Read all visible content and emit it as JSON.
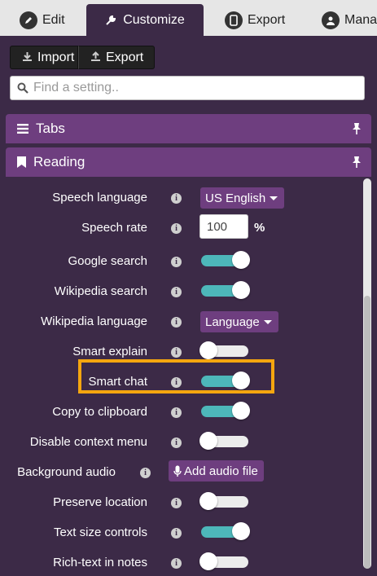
{
  "tabs": [
    {
      "label": "Edit",
      "icon": "pencil-icon",
      "active": false
    },
    {
      "label": "Customize",
      "icon": "wrench-icon",
      "active": true
    },
    {
      "label": "Export",
      "icon": "phone-icon",
      "active": false
    },
    {
      "label": "Manag",
      "icon": "user-icon",
      "active": false
    }
  ],
  "toolbar": {
    "import_label": "Import",
    "export_label": "Export"
  },
  "search": {
    "placeholder": "Find a setting.."
  },
  "panels": {
    "tabs": "Tabs",
    "reading": "Reading"
  },
  "colors": {
    "accent_purple": "#6e3e7f",
    "background": "#3c2a47",
    "toggle_on": "#4db7ba",
    "highlight": "#f5a60f"
  },
  "settings": {
    "speech_language": {
      "label": "Speech language",
      "value": "US English"
    },
    "speech_rate": {
      "label": "Speech rate",
      "value": "100",
      "unit": "%"
    },
    "google_search": {
      "label": "Google search",
      "on": true
    },
    "wikipedia_search": {
      "label": "Wikipedia search",
      "on": true
    },
    "wikipedia_language": {
      "label": "Wikipedia language",
      "value": "Language"
    },
    "smart_explain": {
      "label": "Smart explain",
      "on": false
    },
    "smart_chat": {
      "label": "Smart chat",
      "on": true
    },
    "copy_clipboard": {
      "label": "Copy to clipboard",
      "on": true
    },
    "disable_context_menu": {
      "label": "Disable context menu",
      "on": false
    },
    "background_audio": {
      "label": "Background audio",
      "button": "Add audio file"
    },
    "preserve_location": {
      "label": "Preserve location",
      "on": false
    },
    "text_size_controls": {
      "label": "Text size controls",
      "on": true
    },
    "rich_text_notes": {
      "label": "Rich-text in notes",
      "on": false
    }
  }
}
